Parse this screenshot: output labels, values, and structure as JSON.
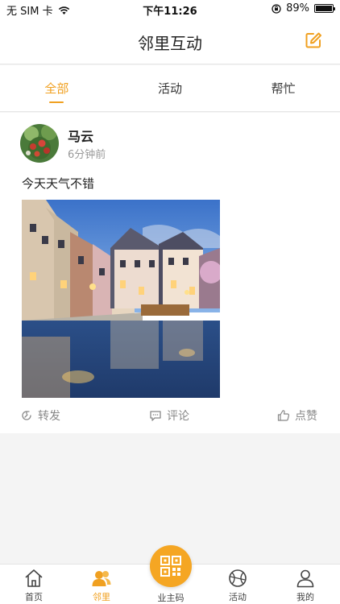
{
  "status_bar": {
    "carrier": "无 SIM 卡",
    "time": "下午11:26",
    "battery_percent": "89%",
    "battery_level": 0.89,
    "icons": [
      "wifi-icon",
      "orientation-lock-icon",
      "battery-icon"
    ]
  },
  "header": {
    "title": "邻里互动",
    "edit_icon": "edit-icon",
    "accent_color": "#f0a020"
  },
  "tabs": [
    {
      "label": "全部",
      "active": true
    },
    {
      "label": "活动",
      "active": false
    },
    {
      "label": "帮忙",
      "active": false
    }
  ],
  "post": {
    "author": "马云",
    "time": "6分钟前",
    "content": "今天天气不错",
    "actions": [
      {
        "label": "转发",
        "icon": "share-icon"
      },
      {
        "label": "评论",
        "icon": "comment-icon"
      },
      {
        "label": "点赞",
        "icon": "like-icon"
      }
    ]
  },
  "tabbar": {
    "items": [
      {
        "label": "首页",
        "icon": "home-icon",
        "active": false
      },
      {
        "label": "邻里",
        "icon": "neighbors-icon",
        "active": true
      },
      {
        "label": "业主码",
        "icon": "qr-code-icon",
        "active": false
      },
      {
        "label": "活动",
        "icon": "ball-icon",
        "active": false
      },
      {
        "label": "我的",
        "icon": "profile-icon",
        "active": false
      }
    ]
  }
}
